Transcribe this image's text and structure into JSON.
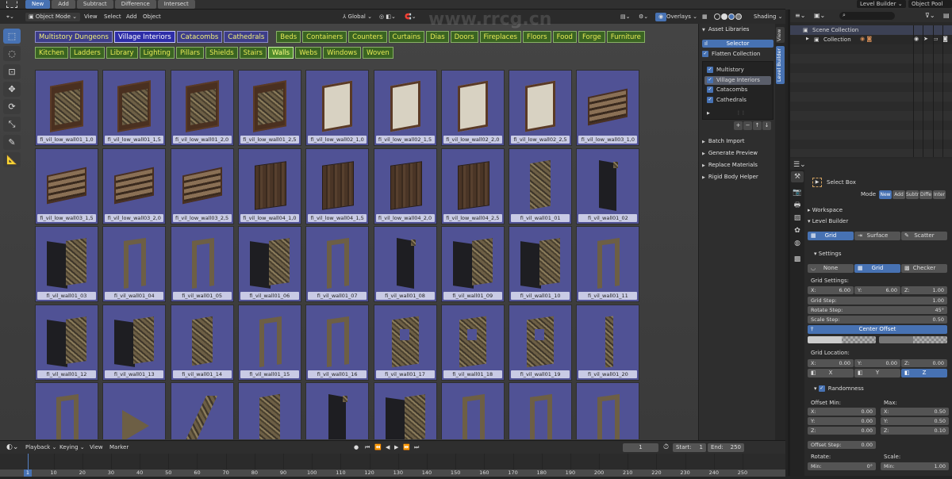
{
  "topbar": {
    "modes": [
      "New",
      "Add",
      "Subtract",
      "Difference",
      "Intersect"
    ],
    "active_mode": "New",
    "workspace": "Level Builder",
    "scene": "Object Pool"
  },
  "viewport_header": {
    "mode": "Object Mode",
    "menus": [
      "View",
      "Select",
      "Add",
      "Object"
    ],
    "orientation": "Global",
    "overlays": "Overlays",
    "shading": "Shading"
  },
  "tools": [
    "select-box",
    "cursor",
    "move",
    "transform",
    "rotate",
    "scale",
    "annotate",
    "measure"
  ],
  "libraries": [
    {
      "label": "Multistory Dungeons",
      "selected": false
    },
    {
      "label": "Village Interiors",
      "selected": true
    },
    {
      "label": "Catacombs",
      "selected": false
    },
    {
      "label": "Cathedrals",
      "selected": false
    }
  ],
  "groups_row1": [
    "Beds",
    "Containers",
    "Counters",
    "Curtains",
    "Dias",
    "Doors",
    "Fireplaces",
    "Floors",
    "Food",
    "Forge",
    "Furniture"
  ],
  "groups_row2": [
    "Kitchen",
    "Ladders",
    "Library",
    "Lighting",
    "Pillars",
    "Shields",
    "Stairs",
    "Walls",
    "Webs",
    "Windows",
    "Woven"
  ],
  "selected_group": "Walls",
  "assets": [
    {
      "name": "fi_vil_low_wall01_1,0",
      "kind": "shelf"
    },
    {
      "name": "fi_vil_low_wall01_1,5",
      "kind": "shelf"
    },
    {
      "name": "fi_vil_low_wall01_2,0",
      "kind": "shelf"
    },
    {
      "name": "fi_vil_low_wall01_2,5",
      "kind": "shelf"
    },
    {
      "name": "fi_vil_low_wall02_1,0",
      "kind": "plaster"
    },
    {
      "name": "fi_vil_low_wall02_1,5",
      "kind": "plaster"
    },
    {
      "name": "fi_vil_low_wall02_2,0",
      "kind": "plaster"
    },
    {
      "name": "fi_vil_low_wall02_2,5",
      "kind": "plaster"
    },
    {
      "name": "fi_vil_low_wall03_1,0",
      "kind": "rack"
    },
    {
      "name": "fi_vil_low_wall03_1,5",
      "kind": "rack"
    },
    {
      "name": "fi_vil_low_wall03_2,0",
      "kind": "rack"
    },
    {
      "name": "fi_vil_low_wall03_2,5",
      "kind": "rack"
    },
    {
      "name": "fi_vil_low_wall04_1,0",
      "kind": "plank"
    },
    {
      "name": "fi_vil_low_wall04_1,5",
      "kind": "plank"
    },
    {
      "name": "fi_vil_low_wall04_2,0",
      "kind": "plank"
    },
    {
      "name": "fi_vil_low_wall04_2,5",
      "kind": "plank"
    },
    {
      "name": "fi_vil_wall01_01",
      "kind": "stone"
    },
    {
      "name": "fi_vil_wall01_02",
      "kind": "dark"
    },
    {
      "name": "fi_vil_wall01_03",
      "kind": "corner"
    },
    {
      "name": "fi_vil_wall01_04",
      "kind": "arch"
    },
    {
      "name": "fi_vil_wall01_05",
      "kind": "arch"
    },
    {
      "name": "fi_vil_wall01_06",
      "kind": "corner"
    },
    {
      "name": "fi_vil_wall01_07",
      "kind": "arch"
    },
    {
      "name": "fi_vil_wall01_08",
      "kind": "dark"
    },
    {
      "name": "fi_vil_wall01_09",
      "kind": "corner"
    },
    {
      "name": "fi_vil_wall01_10",
      "kind": "corner"
    },
    {
      "name": "fi_vil_wall01_11",
      "kind": "arch"
    },
    {
      "name": "fi_vil_wall01_12",
      "kind": "corner"
    },
    {
      "name": "fi_vil_wall01_13",
      "kind": "corner"
    },
    {
      "name": "fi_vil_wall01_14",
      "kind": "stone"
    },
    {
      "name": "fi_vil_wall01_15",
      "kind": "arch"
    },
    {
      "name": "fi_vil_wall01_16",
      "kind": "arch"
    },
    {
      "name": "fi_vil_wall01_17",
      "kind": "window"
    },
    {
      "name": "fi_vil_wall01_18",
      "kind": "window"
    },
    {
      "name": "fi_vil_wall01_19",
      "kind": "window"
    },
    {
      "name": "fi_vil_wall01_20",
      "kind": "pillar"
    },
    {
      "name": "",
      "kind": "arch"
    },
    {
      "name": "",
      "kind": "triangle"
    },
    {
      "name": "",
      "kind": "slant"
    },
    {
      "name": "",
      "kind": "stone"
    },
    {
      "name": "",
      "kind": "dark"
    },
    {
      "name": "",
      "kind": "corner"
    },
    {
      "name": "",
      "kind": "arch"
    },
    {
      "name": "",
      "kind": "arch"
    },
    {
      "name": "",
      "kind": "arch"
    }
  ],
  "npanel": {
    "tabs": [
      "View",
      "Level Builder"
    ],
    "active_tab": "Level Builder",
    "asset_libraries": "Asset Libraries",
    "selector": "Selector",
    "flatten_collection": "Flatten Collection",
    "library_list": [
      {
        "label": "Multistory Dungeons",
        "checked": true
      },
      {
        "label": "Village Interiors",
        "checked": true,
        "active": true
      },
      {
        "label": "Catacombs",
        "checked": true
      },
      {
        "label": "Cathedrals",
        "checked": true
      }
    ],
    "list_buttons": [
      "+",
      "−",
      "↑",
      "↓"
    ],
    "sections": [
      "Batch Import",
      "Generate Preview",
      "Replace Materials",
      "Rigid Body Helper"
    ]
  },
  "outliner": {
    "scene_collection": "Scene Collection",
    "collection": "Collection"
  },
  "properties": {
    "tool_name": "Select Box",
    "mode_label": "Mode",
    "mode_buttons": [
      "New",
      "Add",
      "Subtr",
      "Diffe",
      "Inter"
    ],
    "workspace": "Workspace",
    "level_builder": "Level Builder",
    "placement_modes": [
      "Grid",
      "Surface",
      "Scatter"
    ],
    "settings": "Settings",
    "pattern_modes": [
      "None",
      "Grid",
      "Checker"
    ],
    "grid_settings_label": "Grid Settings:",
    "grid_x": {
      "label": "X:",
      "value": "6.00"
    },
    "grid_y": {
      "label": "Y:",
      "value": "6.00"
    },
    "grid_z": {
      "label": "Z:",
      "value": "1.00"
    },
    "grid_step": {
      "label": "Grid Step:",
      "value": "1.00"
    },
    "rotate_step": {
      "label": "Rotate Step:",
      "value": "45°"
    },
    "scale_step": {
      "label": "Scale Step:",
      "value": "0.50"
    },
    "center_offset": "Center Offset",
    "grid_location_label": "Grid Location:",
    "loc_x": {
      "label": "X:",
      "value": "0.00"
    },
    "loc_y": {
      "label": "Y:",
      "value": "0.00"
    },
    "loc_z": {
      "label": "Z:",
      "value": "0.00"
    },
    "axis_buttons": [
      "X",
      "Y",
      "Z"
    ],
    "randomness": "Randomness",
    "offset_min_label": "Offset Min:",
    "offset_max_label": "Max:",
    "offset_min": [
      {
        "label": "X:",
        "value": "0.00"
      },
      {
        "label": "Y:",
        "value": "0.00"
      },
      {
        "label": "Z:",
        "value": "0.00"
      }
    ],
    "offset_max": [
      {
        "label": "X:",
        "value": "0.50"
      },
      {
        "label": "Y:",
        "value": "0.50"
      },
      {
        "label": "Z:",
        "value": "0.10"
      }
    ],
    "offset_step": {
      "label": "Offset Step:",
      "value": "0.00"
    },
    "rotate_label": "Rotate:",
    "scale_label": "Scale:",
    "rotate_min": {
      "label": "Min:",
      "value": "0°"
    },
    "scale_min": {
      "label": "Min:",
      "value": "1.00"
    }
  },
  "timeline": {
    "menus": [
      "Playback",
      "Keying",
      "View",
      "Marker"
    ],
    "current_frame": "1",
    "start": {
      "label": "Start:",
      "value": "1"
    },
    "end": {
      "label": "End:",
      "value": "250"
    },
    "ticks": [
      "1",
      "10",
      "20",
      "30",
      "40",
      "50",
      "60",
      "70",
      "80",
      "90",
      "100",
      "110",
      "120",
      "130",
      "140",
      "150",
      "160",
      "170",
      "180",
      "190",
      "200",
      "210",
      "220",
      "230",
      "240",
      "250"
    ]
  },
  "watermark": "www.rrcg.cn"
}
